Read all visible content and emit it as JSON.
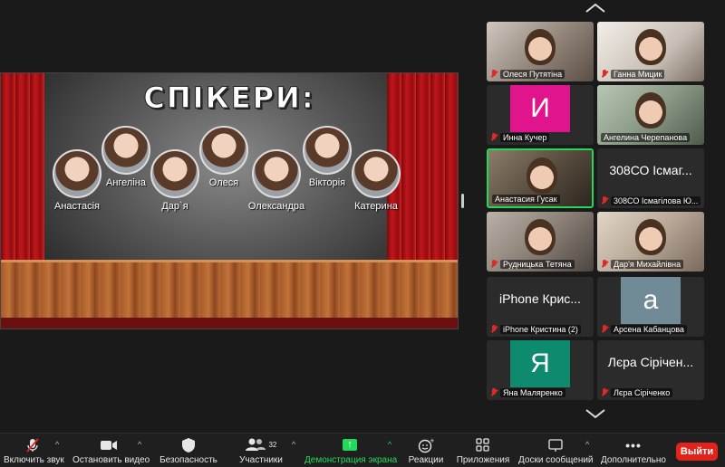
{
  "share": {
    "slide_title": "СПІКЕРИ:",
    "speakers": [
      {
        "name": "Анастасія"
      },
      {
        "name": "Ангеліна"
      },
      {
        "name": "Дар`я"
      },
      {
        "name": "Олеся"
      },
      {
        "name": "Олександра"
      },
      {
        "name": "Вікторія"
      },
      {
        "name": "Катерина"
      }
    ]
  },
  "gallery": {
    "tiles": [
      {
        "label": "Олеся Путятіна",
        "kind": "video",
        "muted": true
      },
      {
        "label": "Ганна Мицик",
        "kind": "video",
        "muted": true
      },
      {
        "label": "Инна Кучер",
        "kind": "avatar",
        "initial": "И",
        "color": "#e0148c",
        "muted": true
      },
      {
        "label": "Ангелина Черепанова",
        "kind": "video",
        "muted": false
      },
      {
        "label": "Анастасия Гусак",
        "kind": "video",
        "muted": false,
        "active": true
      },
      {
        "label": "308СО Ісмагілова Ю...",
        "kind": "name",
        "bigname": "308СО Ісмаг...",
        "muted": true
      },
      {
        "label": "Рудницька Тетяна",
        "kind": "video",
        "muted": true
      },
      {
        "label": "Дар'я Михайлівна",
        "kind": "video",
        "muted": true
      },
      {
        "label": "iPhone Кристина (2)",
        "kind": "name",
        "bigname": "iPhone Крис...",
        "muted": true
      },
      {
        "label": "Арсена Кабанцова",
        "kind": "avatar",
        "initial": "а",
        "color": "#708a96",
        "muted": true
      },
      {
        "label": "Яна Маляренко",
        "kind": "avatar",
        "initial": "Я",
        "color": "#0e8a6e",
        "muted": true
      },
      {
        "label": "Лєра Сіріченко",
        "kind": "name",
        "bigname": "Лєра Сірічен...",
        "muted": true
      }
    ]
  },
  "toolbar": {
    "mute_label": "Включить звук",
    "video_label": "Остановить видео",
    "security_label": "Безопасность",
    "participants_label": "Участники",
    "participants_count": "32",
    "share_label": "Демонстрация экрана",
    "reactions_label": "Реакции",
    "apps_label": "Приложения",
    "whiteboard_label": "Доски сообщений",
    "more_label": "Дополнительно",
    "leave_label": "Выйти"
  },
  "colors": {
    "accent_green": "#23d95b",
    "leave_red": "#e0241c",
    "background": "#1a1a1a"
  }
}
